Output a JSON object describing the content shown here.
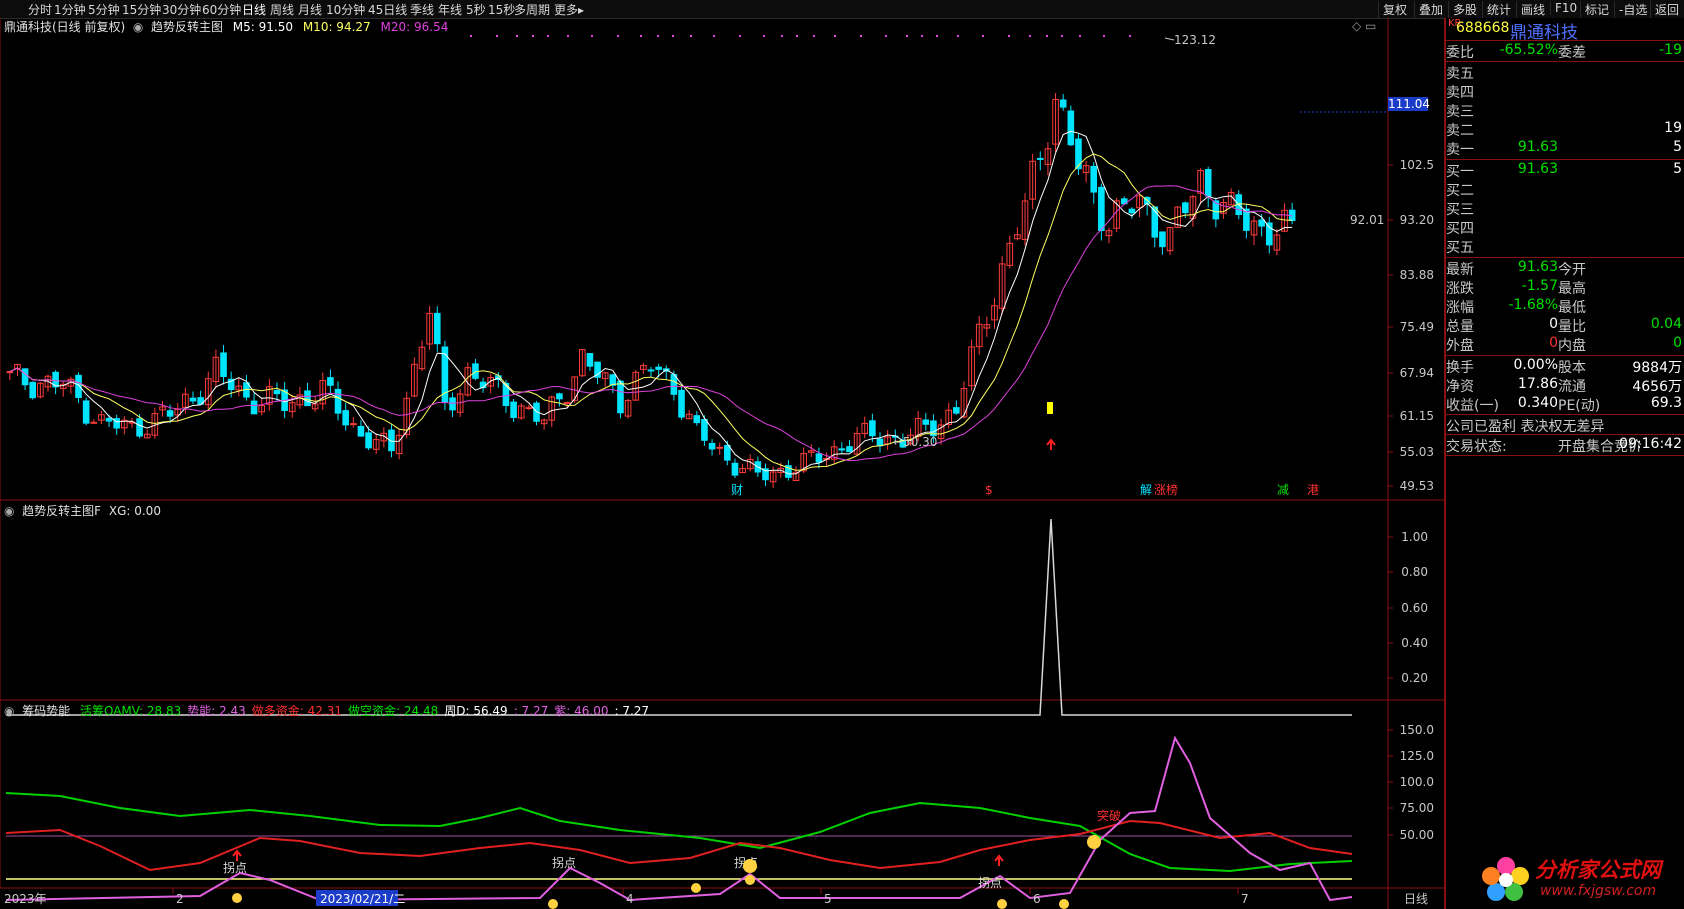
{
  "toolbar": {
    "periods": [
      "分时",
      "1分钟",
      "5分钟",
      "15分钟",
      "30分钟",
      "60分钟",
      "日线",
      "周线",
      "月线",
      "10分钟",
      "45日线",
      "季线",
      "年线",
      "5秒",
      "15秒",
      "多周期",
      "更多▸"
    ],
    "active_period": "日线",
    "right_buttons": [
      "复权",
      "叠加",
      "多股",
      "统计",
      "画线",
      "F10",
      "标记",
      "-自选",
      "返回"
    ]
  },
  "main_chart": {
    "title": "鼎通科技(日线 前复权)",
    "formula": "趋势反转主图",
    "ma5_label": "M5: 91.50",
    "ma10_label": "M10: 94.27",
    "ma20_label": "M20: 96.54",
    "high_label": "123.12",
    "low_label": "←50.30",
    "last_label": "92.01",
    "price_tag": "111.04",
    "yticks": [
      "102.5",
      "93.20",
      "83.88",
      "75.49",
      "67.94",
      "61.15",
      "55.03",
      "49.53"
    ],
    "events": [
      "财",
      "$",
      "解",
      "涨榜",
      "减",
      "港"
    ],
    "colors": {
      "up": "#ff3c3c",
      "down": "#00e5ff",
      "ma5": "#ffffff",
      "ma10": "#ffff60",
      "ma20": "#e040e0"
    }
  },
  "sub1": {
    "title": "趋势反转主图F",
    "xg_label": "XG: 0.00",
    "yticks": [
      "1.00",
      "0.80",
      "0.60",
      "0.40",
      "0.20"
    ]
  },
  "sub2": {
    "title": "筹码势能",
    "items": [
      {
        "label": "活筹OAMV: 28.83",
        "color": "#00e000"
      },
      {
        "label": "势能: 2.43",
        "color": "#e060e0"
      },
      {
        "label": "做多资金: 42.31",
        "color": "#ff3030"
      },
      {
        "label": "做空资金: 24.48",
        "color": "#00e000"
      },
      {
        "label": "周D: 56.49",
        "color": "#ffffff"
      },
      {
        "label": ": 7.27",
        "color": "#e060e0"
      },
      {
        "label": "紫: 46.00",
        "color": "#e060e0"
      },
      {
        "label": ": 7.27",
        "color": "#ffffff"
      }
    ],
    "yticks": [
      "150.0",
      "125.0",
      "100.0",
      "75.00",
      "50.00"
    ],
    "annotations": [
      "拐点",
      "拐点",
      "拐点",
      "拐点",
      "突破"
    ]
  },
  "xaxis": {
    "labels": [
      "2023年",
      "2",
      "2023/02/21/二",
      "4",
      "5",
      "6",
      "7"
    ],
    "right_label": "日线"
  },
  "side": {
    "code": "688668",
    "name": "鼎通科技",
    "kr": "KR",
    "weibi": {
      "label": "委比",
      "value": "-65.52%",
      "label2": "委差",
      "value2": "-19"
    },
    "asks": [
      {
        "label": "卖五",
        "price": "",
        "vol": ""
      },
      {
        "label": "卖四",
        "price": "",
        "vol": ""
      },
      {
        "label": "卖三",
        "price": "",
        "vol": ""
      },
      {
        "label": "卖二",
        "price": "",
        "vol": "19"
      },
      {
        "label": "卖一",
        "price": "91.63",
        "vol": "5"
      }
    ],
    "bids": [
      {
        "label": "买一",
        "price": "91.63",
        "vol": "5"
      },
      {
        "label": "买二",
        "price": "",
        "vol": ""
      },
      {
        "label": "买三",
        "price": "",
        "vol": ""
      },
      {
        "label": "买四",
        "price": "",
        "vol": ""
      },
      {
        "label": "买五",
        "price": "",
        "vol": ""
      }
    ],
    "quote": [
      {
        "l1": "最新",
        "v1": "91.63",
        "l2": "今开",
        "v2": ""
      },
      {
        "l1": "涨跌",
        "v1": "-1.57",
        "l2": "最高",
        "v2": ""
      },
      {
        "l1": "涨幅",
        "v1": "-1.68%",
        "l2": "最低",
        "v2": ""
      },
      {
        "l1": "总量",
        "v1": "0",
        "l2": "量比",
        "v2": "0.04"
      },
      {
        "l1": "外盘",
        "v1": "0",
        "l2": "内盘",
        "v2": "0"
      }
    ],
    "fin": [
      {
        "l1": "换手",
        "v1": "0.00%",
        "l2": "股本",
        "v2": "9884万"
      },
      {
        "l1": "净资",
        "v1": "17.86",
        "l2": "流通",
        "v2": "4656万"
      },
      {
        "l1": "收益(一)",
        "v1": "0.340",
        "l2": "PE(动)",
        "v2": "69.3"
      }
    ],
    "note": "公司已盈利 表决权无差异",
    "status_label": "交易状态:",
    "status_value": "开盘集合竞价",
    "time": "09:16:42"
  },
  "watermark": {
    "text": "分析家公式网",
    "url": "www.fxjgsw.com"
  }
}
